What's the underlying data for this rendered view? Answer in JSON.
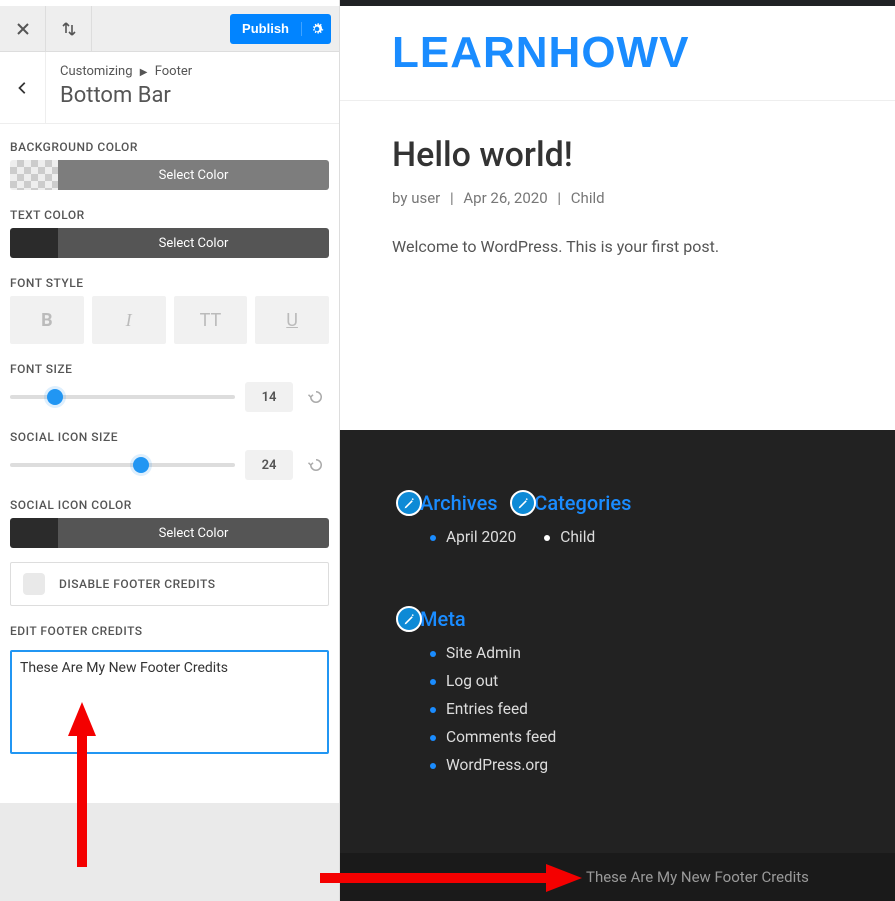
{
  "topbar": {
    "publish_label": "Publish"
  },
  "header": {
    "breadcrumb_root": "Customizing",
    "breadcrumb_leaf": "Footer",
    "title": "Bottom Bar"
  },
  "sections": {
    "bg_color_label": "BACKGROUND COLOR",
    "text_color_label": "TEXT COLOR",
    "select_color": "Select Color",
    "font_style_label": "FONT STYLE",
    "font_size_label": "FONT SIZE",
    "font_size_value": "14",
    "social_size_label": "SOCIAL ICON SIZE",
    "social_size_value": "24",
    "social_color_label": "SOCIAL ICON COLOR",
    "disable_credits_label": "DISABLE FOOTER CREDITS",
    "edit_credits_label": "EDIT FOOTER CREDITS",
    "credits_value": "These Are My New Footer Credits"
  },
  "font_style_buttons": {
    "b": "B",
    "i": "I",
    "tt": "TT",
    "u": "U"
  },
  "preview": {
    "site_title": "LEARNHOWV",
    "post_title": "Hello world!",
    "meta_by": "by",
    "meta_author": "user",
    "meta_date": "Apr 26, 2020",
    "meta_cat": "Child",
    "post_body": "Welcome to WordPress. This is your first post."
  },
  "widgets": {
    "archives_title": "Archives",
    "archives_items": [
      "April 2020"
    ],
    "categories_title": "Categories",
    "categories_items": [
      "Child"
    ],
    "meta_title": "Meta",
    "meta_items": [
      "Site Admin",
      "Log out",
      "Entries feed",
      "Comments feed",
      "WordPress.org"
    ]
  },
  "bottombar": {
    "credits_output": "These Are My New Footer Credits"
  }
}
